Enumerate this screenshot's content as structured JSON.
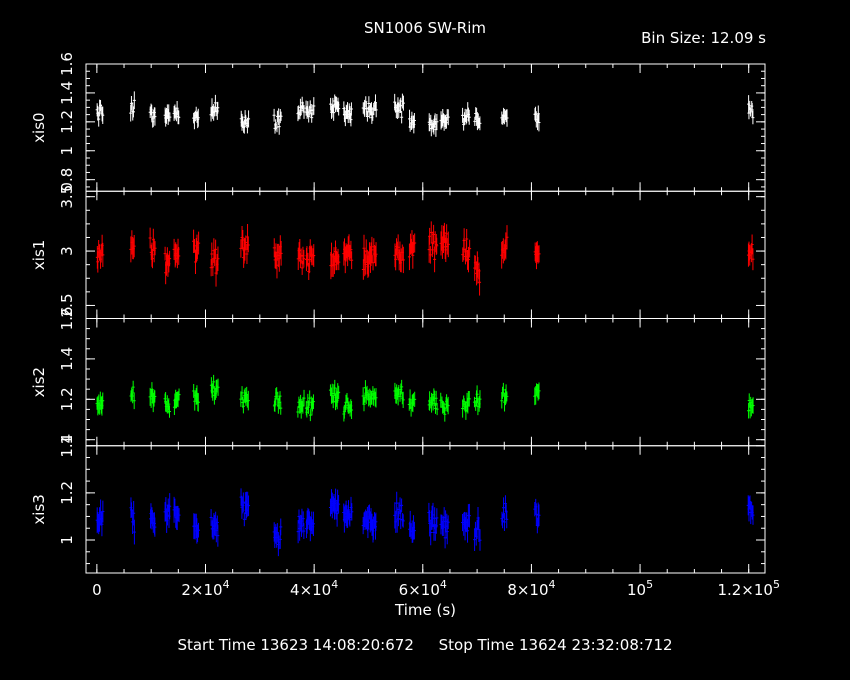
{
  "title": "SN1006 SW-Rim",
  "bin_size": "Bin Size: 12.09 s",
  "start_time": "Start Time 13623 14:08:20:672",
  "stop_time": "Stop Time 13624 23:32:08:712",
  "chart_data": {
    "type": "scatter",
    "style": "error-bar light curve, stacked panels sharing x axis",
    "xlabel": "Time (s)",
    "xlim": [
      -2000,
      123000
    ],
    "x_ticks": [
      {
        "value": 0,
        "label": "0"
      },
      {
        "value": 20000,
        "label": "2×10",
        "exp": "4"
      },
      {
        "value": 40000,
        "label": "4×10",
        "exp": "4"
      },
      {
        "value": 60000,
        "label": "6×10",
        "exp": "4"
      },
      {
        "value": 80000,
        "label": "8×10",
        "exp": "4"
      },
      {
        "value": 100000,
        "label": "10",
        "exp": "5"
      },
      {
        "value": 120000,
        "label": "1.2×10",
        "exp": "5"
      }
    ],
    "grid": false,
    "segments": [
      [
        0,
        1200
      ],
      [
        6200,
        7000
      ],
      [
        9800,
        10800
      ],
      [
        12500,
        13500
      ],
      [
        14200,
        15200
      ],
      [
        17800,
        18800
      ],
      [
        21000,
        22400
      ],
      [
        26500,
        28000
      ],
      [
        32600,
        34000
      ],
      [
        37000,
        38200
      ],
      [
        38500,
        40000
      ],
      [
        43000,
        44600
      ],
      [
        45400,
        47000
      ],
      [
        49000,
        51500
      ],
      [
        54800,
        56500
      ],
      [
        57500,
        58600
      ],
      [
        61100,
        62700
      ],
      [
        63300,
        64800
      ],
      [
        67300,
        68700
      ],
      [
        69500,
        70600
      ],
      [
        74500,
        75600
      ],
      [
        80600,
        81500
      ],
      [
        119900,
        120900
      ]
    ],
    "panels": [
      {
        "name": "xis0",
        "color": "#ffffff",
        "ylim": [
          0.72,
          1.6
        ],
        "yticks": [
          0.8,
          1,
          1.2,
          1.4,
          1.6
        ],
        "ytick_labels": [
          "0.8",
          "1",
          "1.2",
          "1.4",
          "1.6"
        ],
        "mean": 1.25,
        "spread": 0.09
      },
      {
        "name": "xis1",
        "color": "#ff0000",
        "ylim": [
          2.38,
          3.55
        ],
        "yticks": [
          2.5,
          3,
          3.5
        ],
        "ytick_labels": [
          "2.5",
          "3",
          "3.5"
        ],
        "mean": 2.98,
        "spread": 0.18
      },
      {
        "name": "xis2",
        "color": "#00ff00",
        "ylim": [
          0.97,
          1.6
        ],
        "yticks": [
          1,
          1.2,
          1.4,
          1.6
        ],
        "ytick_labels": [
          "1",
          "1.2",
          "1.4",
          "1.6"
        ],
        "mean": 1.2,
        "spread": 0.07
      },
      {
        "name": "xis3",
        "color": "#0000ff",
        "ylim": [
          0.86,
          1.4
        ],
        "yticks": [
          1,
          1.2,
          1.4
        ],
        "ytick_labels": [
          "1",
          "1.2",
          "1.4"
        ],
        "mean": 1.09,
        "spread": 0.08
      }
    ]
  }
}
